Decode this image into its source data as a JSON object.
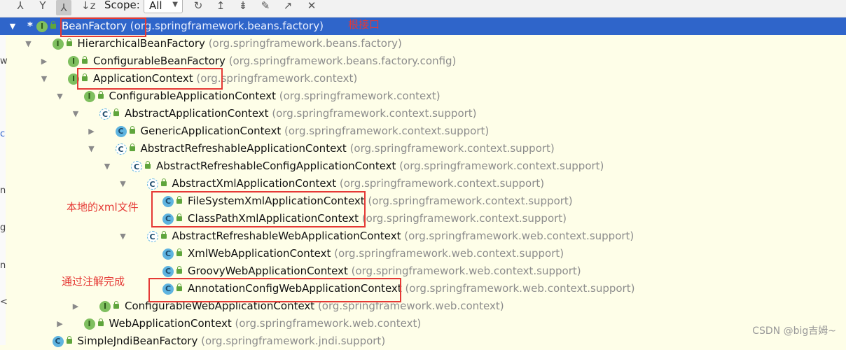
{
  "toolbar": {
    "scope_label": "Scope:",
    "scope_value": "All",
    "icons": [
      "supertypes-icon",
      "subtypes-icon",
      "hierarchy-icon",
      "sort-alpha-icon",
      "refresh-icon",
      "expand-up-icon",
      "collapse-all-icon",
      "pin-icon",
      "export-icon",
      "close-icon"
    ]
  },
  "tree": [
    {
      "name": "BeanFactory",
      "pkg": " (org.springframework.beans.factory)",
      "kind": "interface",
      "depth": 0,
      "selected": true,
      "star": true,
      "arrow": "▼"
    },
    {
      "name": "HierarchicalBeanFactory",
      "pkg": " (org.springframework.beans.factory)",
      "kind": "interface",
      "depth": 1,
      "arrow": "▼"
    },
    {
      "name": "ConfigurableBeanFactory",
      "pkg": " (org.springframework.beans.factory.config)",
      "kind": "interface",
      "depth": 2,
      "arrow": "▶"
    },
    {
      "name": "ApplicationContext",
      "pkg": " (org.springframework.context)",
      "kind": "interface",
      "depth": 2,
      "arrow": "▼"
    },
    {
      "name": "ConfigurableApplicationContext",
      "pkg": " (org.springframework.context)",
      "kind": "interface",
      "depth": 3,
      "arrow": "▼"
    },
    {
      "name": "AbstractApplicationContext",
      "pkg": " (org.springframework.context.support)",
      "kind": "abstract",
      "depth": 4,
      "arrow": "▼"
    },
    {
      "name": "GenericApplicationContext",
      "pkg": " (org.springframework.context.support)",
      "kind": "class",
      "depth": 5,
      "arrow": "▶"
    },
    {
      "name": "AbstractRefreshableApplicationContext",
      "pkg": " (org.springframework.context.support)",
      "kind": "abstract",
      "depth": 5,
      "arrow": "▼"
    },
    {
      "name": "AbstractRefreshableConfigApplicationContext",
      "pkg": " (org.springframework.context.support)",
      "kind": "abstract",
      "depth": 6,
      "arrow": "▼"
    },
    {
      "name": "AbstractXmlApplicationContext",
      "pkg": " (org.springframework.context.support)",
      "kind": "abstract",
      "depth": 7,
      "arrow": "▼"
    },
    {
      "name": "FileSystemXmlApplicationContext",
      "pkg": " (org.springframework.context.support)",
      "kind": "class",
      "depth": 8,
      "arrow": ""
    },
    {
      "name": "ClassPathXmlApplicationContext",
      "pkg": " (org.springframework.context.support)",
      "kind": "class",
      "depth": 8,
      "arrow": ""
    },
    {
      "name": "AbstractRefreshableWebApplicationContext",
      "pkg": " (org.springframework.web.context.support)",
      "kind": "abstract",
      "depth": 7,
      "arrow": "▼"
    },
    {
      "name": "XmlWebApplicationContext",
      "pkg": " (org.springframework.web.context.support)",
      "kind": "class",
      "depth": 8,
      "arrow": ""
    },
    {
      "name": "GroovyWebApplicationContext",
      "pkg": " (org.springframework.web.context.support)",
      "kind": "class",
      "depth": 8,
      "arrow": ""
    },
    {
      "name": "AnnotationConfigWebApplicationContext",
      "pkg": " (org.springframework.web.context.support)",
      "kind": "class",
      "depth": 8,
      "arrow": ""
    },
    {
      "name": "ConfigurableWebApplicationContext",
      "pkg": " (org.springframework.web.context)",
      "kind": "interface",
      "depth": 4,
      "arrow": "▶"
    },
    {
      "name": "WebApplicationContext",
      "pkg": " (org.springframework.web.context)",
      "kind": "interface",
      "depth": 3,
      "arrow": "▶"
    },
    {
      "name": "SimpleJndiBeanFactory",
      "pkg": " (org.springframework.jndi.support)",
      "kind": "class",
      "depth": 1,
      "arrow": ""
    }
  ],
  "annotations": {
    "root_interface": "根接口",
    "local_xml": "本地的xml文件",
    "via_annotation": "通过注解完成"
  },
  "watermark": "CSDN @big吉姆~",
  "colors": {
    "selection": "#2f65ca",
    "annotation": "#e53935",
    "background": "#fefee8"
  }
}
